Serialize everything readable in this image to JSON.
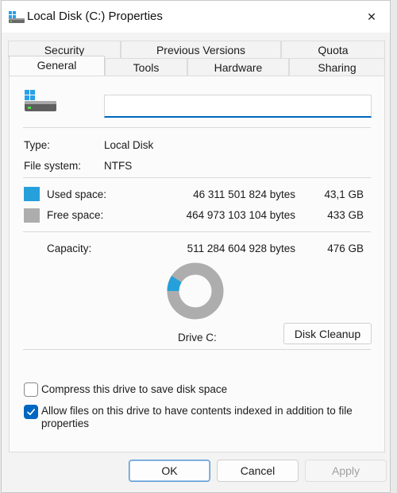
{
  "window": {
    "title": "Local Disk (C:) Properties",
    "close_glyph": "✕"
  },
  "tabs_back": [
    "Security",
    "Previous Versions",
    "Quota"
  ],
  "tabs_front": [
    "General",
    "Tools",
    "Hardware",
    "Sharing"
  ],
  "active_tab": "General",
  "general": {
    "volume_label_value": "",
    "type_label": "Type:",
    "type_value": "Local Disk",
    "fs_label": "File system:",
    "fs_value": "NTFS",
    "used": {
      "label": "Used space:",
      "bytes": "46 311 501 824 bytes",
      "size": "43,1 GB",
      "color": "#26a0da"
    },
    "free": {
      "label": "Free space:",
      "bytes": "464 973 103 104 bytes",
      "size": "433 GB",
      "color": "#adadad"
    },
    "capacity": {
      "label": "Capacity:",
      "bytes": "511 284 604 928 bytes",
      "size": "476 GB"
    },
    "used_fraction": 0.0906,
    "drive_label": "Drive C:",
    "cleanup_button": "Disk Cleanup",
    "compress_label": "Compress this drive to save disk space",
    "compress_checked": false,
    "index_label": "Allow files on this drive to have contents indexed in addition to file properties",
    "index_checked": true
  },
  "footer": {
    "ok": "OK",
    "cancel": "Cancel",
    "apply": "Apply"
  },
  "icons": {
    "title": "drive-icon",
    "drive": "drive-icon",
    "close": "close-icon",
    "check": "checkmark-icon"
  }
}
